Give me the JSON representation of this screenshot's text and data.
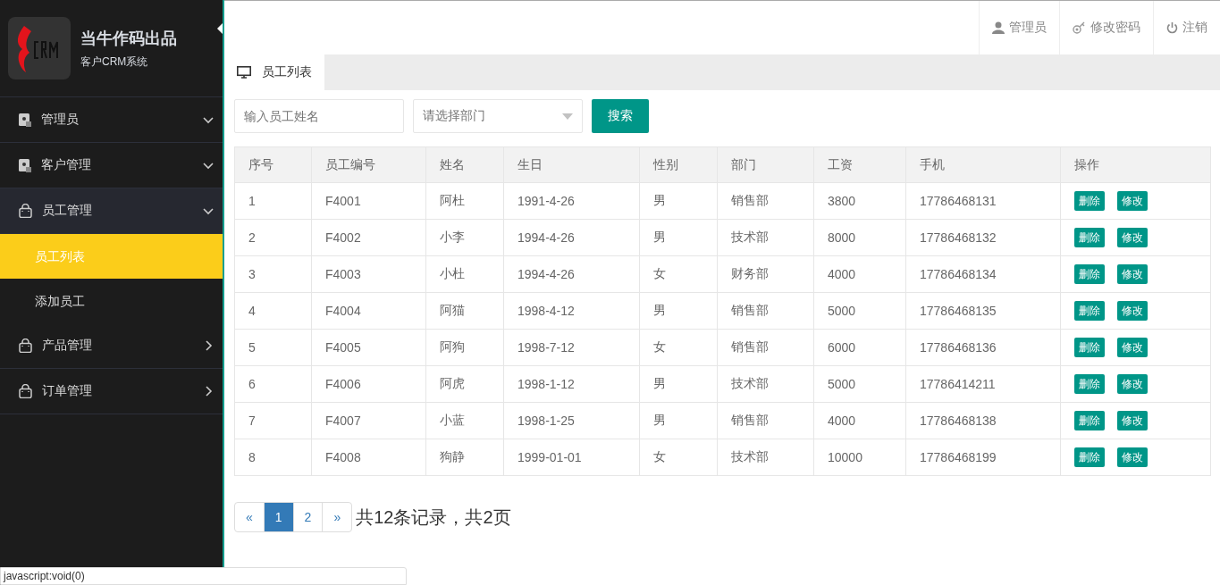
{
  "brand": {
    "title": "当牛作码出品",
    "subtitle": "客户CRM系统"
  },
  "sidebar": {
    "items": [
      {
        "label": "管理员",
        "kind": "card",
        "expanded": false,
        "chevron_down": true
      },
      {
        "label": "客户管理",
        "kind": "card",
        "expanded": false,
        "chevron_down": true
      },
      {
        "label": "员工管理",
        "kind": "bag",
        "expanded": true,
        "chevron_down": true,
        "children": [
          {
            "label": "员工列表",
            "selected": true
          },
          {
            "label": "添加员工",
            "selected": false
          }
        ]
      },
      {
        "label": "产品管理",
        "kind": "bag",
        "expanded": false,
        "chevron_down": false
      },
      {
        "label": "订单管理",
        "kind": "bag",
        "expanded": false,
        "chevron_down": false
      }
    ]
  },
  "topbar": {
    "items": [
      {
        "label": "管理员",
        "kind": "user"
      },
      {
        "label": "修改密码",
        "kind": "key"
      },
      {
        "label": "注销",
        "kind": "power"
      }
    ]
  },
  "tabs": [
    {
      "label": "员工列表",
      "selected": true
    }
  ],
  "search": {
    "name_placeholder": "输入员工姓名",
    "dept_placeholder": "请选择部门",
    "button": "搜索"
  },
  "table": {
    "columns": [
      "序号",
      "员工编号",
      "姓名",
      "生日",
      "性别",
      "部门",
      "工资",
      "手机",
      "操作"
    ],
    "rows": [
      {
        "cells": [
          "1",
          "F4001",
          "阿杜",
          "1991-4-26",
          "男",
          "销售部",
          "3800",
          "17786468131"
        ],
        "actions": [
          "删除",
          "修改"
        ]
      },
      {
        "cells": [
          "2",
          "F4002",
          "小李",
          "1994-4-26",
          "男",
          "技术部",
          "8000",
          "17786468132"
        ],
        "actions": [
          "删除",
          "修改"
        ]
      },
      {
        "cells": [
          "3",
          "F4003",
          "小杜",
          "1994-4-26",
          "女",
          "财务部",
          "4000",
          "17786468134"
        ],
        "actions": [
          "删除",
          "修改"
        ]
      },
      {
        "cells": [
          "4",
          "F4004",
          "阿猫",
          "1998-4-12",
          "男",
          "销售部",
          "5000",
          "17786468135"
        ],
        "actions": [
          "删除",
          "修改"
        ]
      },
      {
        "cells": [
          "5",
          "F4005",
          "阿狗",
          "1998-7-12",
          "女",
          "销售部",
          "6000",
          "17786468136"
        ],
        "actions": [
          "删除",
          "修改"
        ]
      },
      {
        "cells": [
          "6",
          "F4006",
          "阿虎",
          "1998-1-12",
          "男",
          "技术部",
          "5000",
          "17786414211"
        ],
        "actions": [
          "删除",
          "修改"
        ]
      },
      {
        "cells": [
          "7",
          "F4007",
          "小蓝",
          "1998-1-25",
          "男",
          "销售部",
          "4000",
          "17786468138"
        ],
        "actions": [
          "删除",
          "修改"
        ]
      },
      {
        "cells": [
          "8",
          "F4008",
          "狗静",
          "1999-01-01",
          "女",
          "技术部",
          "10000",
          "17786468199"
        ],
        "actions": [
          "删除",
          "修改"
        ]
      }
    ]
  },
  "pagination": {
    "prev": "«",
    "pages": [
      {
        "label": "1",
        "selected": true
      },
      {
        "label": "2",
        "selected": false
      }
    ],
    "next": "»",
    "summary": "共12条记录，共2页"
  },
  "status_bar": "javascript:void(0)"
}
